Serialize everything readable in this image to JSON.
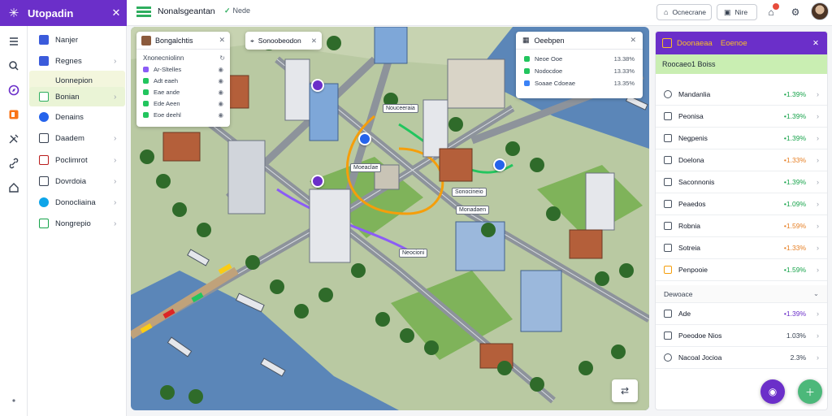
{
  "app": {
    "brand": "Utopadin"
  },
  "sidebar": {
    "items": [
      {
        "label": "Nanjer",
        "color": "#3b5bdb",
        "chevron": false
      },
      {
        "label": "Regnes",
        "color": "#3b5bdb",
        "chevron": true
      },
      {
        "label": "Uonnepion",
        "color": "#8b5a3c",
        "chevron": false,
        "active": true
      },
      {
        "label": "Bonian",
        "color": "#2fae5f",
        "chevron": true,
        "active2": true
      },
      {
        "label": "Denains",
        "color": "#2563eb",
        "chevron": false
      },
      {
        "label": "Daadem",
        "color": "#374151",
        "chevron": true
      },
      {
        "label": "Poclimrot",
        "color": "#b91c1c",
        "chevron": true
      },
      {
        "label": "Dovrdoia",
        "color": "#374151",
        "chevron": true
      },
      {
        "label": "Donocliaina",
        "color": "#0ea5e9",
        "chevron": true
      },
      {
        "label": "Nongrepio",
        "color": "#16a34a",
        "chevron": true
      }
    ]
  },
  "topbar": {
    "title": "Nonalsgeantan",
    "badge": "Nede",
    "btn_report": "Ocnecrane",
    "btn_filter": "Nire"
  },
  "map": {
    "legend": {
      "title": "Bongalchtis",
      "subtitle": "Xnonecniolinn",
      "items": [
        {
          "label": "Ar-Sltelles",
          "color": "#8b5cf6"
        },
        {
          "label": "Adt eaeh",
          "color": "#22c55e"
        },
        {
          "label": "Eae ande",
          "color": "#22c55e"
        },
        {
          "label": "Ede Aeen",
          "color": "#22c55e"
        },
        {
          "label": "Eoe deehl",
          "color": "#22c55e"
        }
      ]
    },
    "search": {
      "value": "Sonoobeodon"
    },
    "layers": {
      "title": "Oeebpen",
      "items": [
        {
          "label": "Neoe Ooe",
          "value": "13.38%",
          "color": "#22c55e"
        },
        {
          "label": "Nodocdoe",
          "value": "13.33%",
          "color": "#22c55e"
        },
        {
          "label": "Soaae Cdoeae",
          "value": "13.35%",
          "color": "#3b82f6"
        }
      ]
    },
    "labels": [
      "Nouceeraia",
      "Moeaclae",
      "Sonocineio",
      "Monadaen",
      "Neocioni"
    ]
  },
  "rpanel": {
    "title_a": "Doonaeaa",
    "title_b": "Eoenoe",
    "subtitle": "Roocaeo1 Boiss",
    "rows": [
      {
        "label": "Mandanlia",
        "value": "•1.39%",
        "trend": "up"
      },
      {
        "label": "Peonisa",
        "value": "•1.39%",
        "trend": "up"
      },
      {
        "label": "Negpenis",
        "value": "•1.39%",
        "trend": "up"
      },
      {
        "label": "Doelona",
        "value": "•1.33%",
        "trend": "dn"
      },
      {
        "label": "Saconnonis",
        "value": "•1.39%",
        "trend": "up"
      },
      {
        "label": "Peaedos",
        "value": "•1.09%",
        "trend": "up"
      },
      {
        "label": "Robnia",
        "value": "•1.59%",
        "trend": "dn"
      },
      {
        "label": "Sotreia",
        "value": "•1.33%",
        "trend": "dn"
      },
      {
        "label": "Penpooie",
        "value": "•1.59%",
        "trend": "up"
      }
    ],
    "section": "Dewoace",
    "rows2": [
      {
        "label": "Ade",
        "value": "•1.39%"
      },
      {
        "label": "Poeodoe Nios",
        "value": "1.03%"
      },
      {
        "label": "Nacoal Jocioa",
        "value": "2.3%"
      }
    ]
  }
}
